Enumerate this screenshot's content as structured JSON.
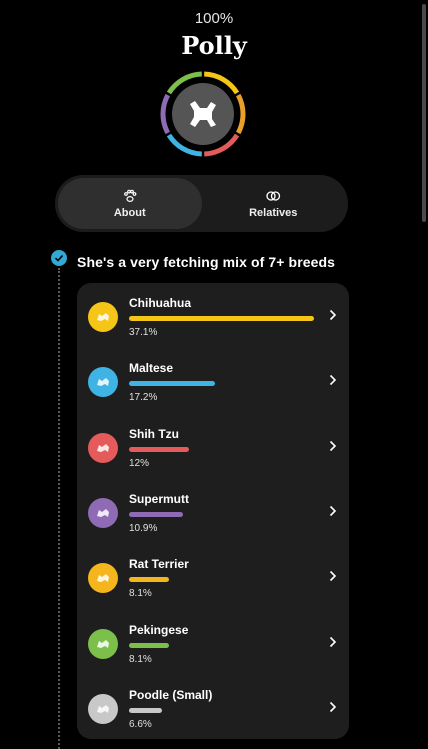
{
  "header": {
    "percent": "100%",
    "dog_name": "Polly"
  },
  "avatar": {
    "icon": "dog-silhouette-icon",
    "ring_colors": [
      "#f5c518",
      "#e9a02b",
      "#e55b5b",
      "#3fb3e3",
      "#8e6bb4",
      "#7cc04b"
    ]
  },
  "tabs": [
    {
      "label": "About",
      "icon": "paw-icon",
      "active": true
    },
    {
      "label": "Relatives",
      "icon": "rings-icon",
      "active": false
    }
  ],
  "section": {
    "title": "She's a very fetching mix of 7+ breeds",
    "accent_color": "#31a8d6"
  },
  "breeds": [
    {
      "name": "Chihuahua",
      "percent_label": "37.1%",
      "percent": 37.1,
      "color": "#f5c518",
      "icon": "chihuahua-icon"
    },
    {
      "name": "Maltese",
      "percent_label": "17.2%",
      "percent": 17.2,
      "color": "#3fb3e3",
      "icon": "maltese-icon"
    },
    {
      "name": "Shih Tzu",
      "percent_label": "12%",
      "percent": 12,
      "color": "#e55b5b",
      "icon": "shih-tzu-icon"
    },
    {
      "name": "Supermutt",
      "percent_label": "10.9%",
      "percent": 10.9,
      "color": "#8e6bb4",
      "icon": "supermutt-icon"
    },
    {
      "name": "Rat Terrier",
      "percent_label": "8.1%",
      "percent": 8.1,
      "color": "#f5b51c",
      "icon": "rat-terrier-icon"
    },
    {
      "name": "Pekingese",
      "percent_label": "8.1%",
      "percent": 8.1,
      "color": "#7cc04b",
      "icon": "pekingese-icon"
    },
    {
      "name": "Poodle (Small)",
      "percent_label": "6.6%",
      "percent": 6.6,
      "color": "#c8c8c8",
      "icon": "poodle-icon"
    }
  ]
}
